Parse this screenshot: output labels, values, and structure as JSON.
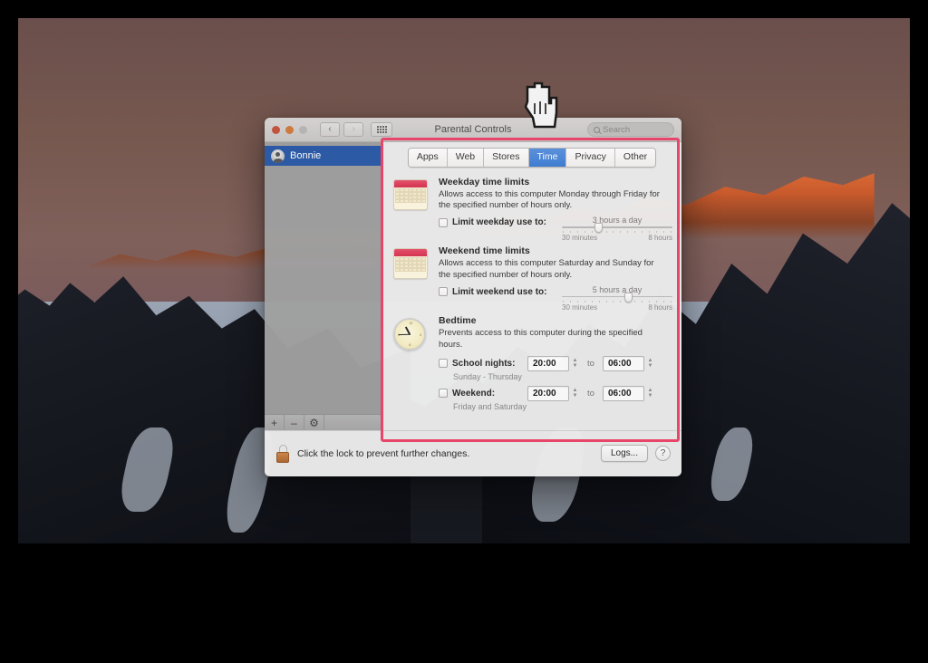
{
  "window": {
    "title": "Parental Controls",
    "search_placeholder": "Search",
    "traffic_lights": [
      "close-button",
      "minimize-button",
      "zoom-button"
    ],
    "nav_back": "‹",
    "nav_forward": "›"
  },
  "sidebar": {
    "users": [
      {
        "name": "Bonnie",
        "selected": true
      }
    ],
    "footer_buttons": [
      {
        "name": "add-user",
        "label": "+"
      },
      {
        "name": "remove-user",
        "label": "–"
      },
      {
        "name": "action-menu",
        "label": "⚙"
      }
    ]
  },
  "tabs": [
    {
      "label": "Apps",
      "active": false
    },
    {
      "label": "Web",
      "active": false
    },
    {
      "label": "Stores",
      "active": false
    },
    {
      "label": "Time",
      "active": true
    },
    {
      "label": "Privacy",
      "active": false
    },
    {
      "label": "Other",
      "active": false
    }
  ],
  "sections": {
    "weekday": {
      "title": "Weekday time limits",
      "description": "Allows access to this computer Monday through Friday for the specified number of hours only.",
      "checkbox_label": "Limit weekday use to:",
      "checked": false,
      "slider_value": "3 hours a day",
      "slider_min_label": "30 minutes",
      "slider_max_label": "8 hours",
      "slider_percent": 33
    },
    "weekend": {
      "title": "Weekend time limits",
      "description": "Allows access to this computer Saturday and Sunday for the specified number of hours only.",
      "checkbox_label": "Limit weekend use to:",
      "checked": false,
      "slider_value": "5 hours a day",
      "slider_min_label": "30 minutes",
      "slider_max_label": "8 hours",
      "slider_percent": 60
    },
    "bedtime": {
      "title": "Bedtime",
      "description": "Prevents access to this computer during the specified hours.",
      "rows": [
        {
          "checkbox_label": "School nights:",
          "checked": false,
          "start_time": "20:00",
          "to_label": "to",
          "end_time": "06:00",
          "sublabel": "Sunday - Thursday"
        },
        {
          "checkbox_label": "Weekend:",
          "checked": false,
          "start_time": "20:00",
          "to_label": "to",
          "end_time": "06:00",
          "sublabel": "Friday and Saturday"
        }
      ]
    }
  },
  "bottom_bar": {
    "lock_message": "Click the lock to prevent further changes.",
    "logs_button": "Logs...",
    "help_button": "?"
  },
  "colors": {
    "accent_blue": "#3e7fd6",
    "highlight_pink": "#e8456b",
    "sidebar_selection": "#2a5aa8",
    "lock_orange": "#b06a33"
  }
}
